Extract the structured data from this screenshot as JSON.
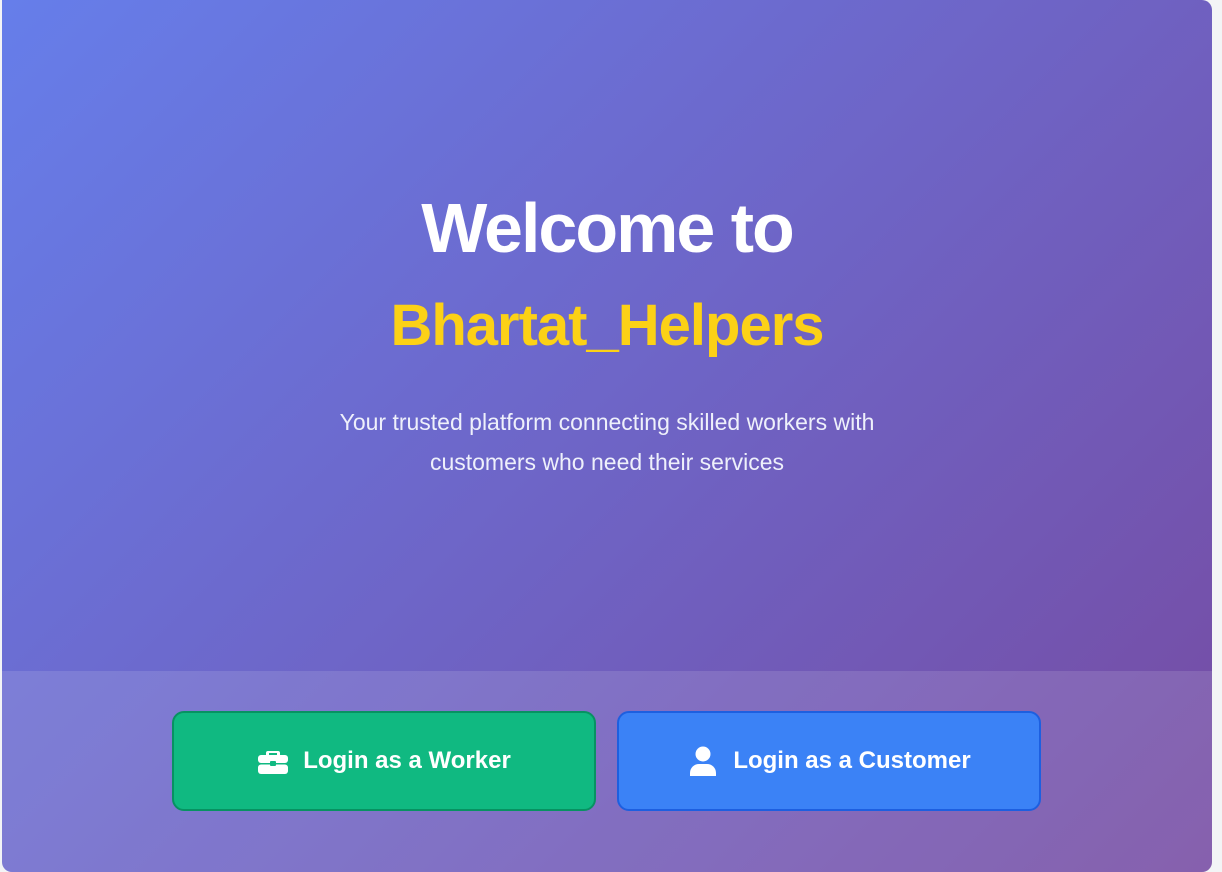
{
  "hero": {
    "title_line": "Welcome to",
    "brand_name": "Bhartat_Helpers",
    "subtitle_line1": "Your trusted platform connecting skilled workers with",
    "subtitle_line2": "customers who need their services"
  },
  "actions": {
    "worker": {
      "label": "Login as a Worker",
      "icon": "briefcase-icon",
      "color": "#10b981"
    },
    "customer": {
      "label": "Login as a Customer",
      "icon": "user-icon",
      "color": "#3b82f6"
    }
  },
  "colors": {
    "gradient_start": "#667eea",
    "gradient_end": "#764ba2",
    "brand_accent": "#fcd116"
  }
}
